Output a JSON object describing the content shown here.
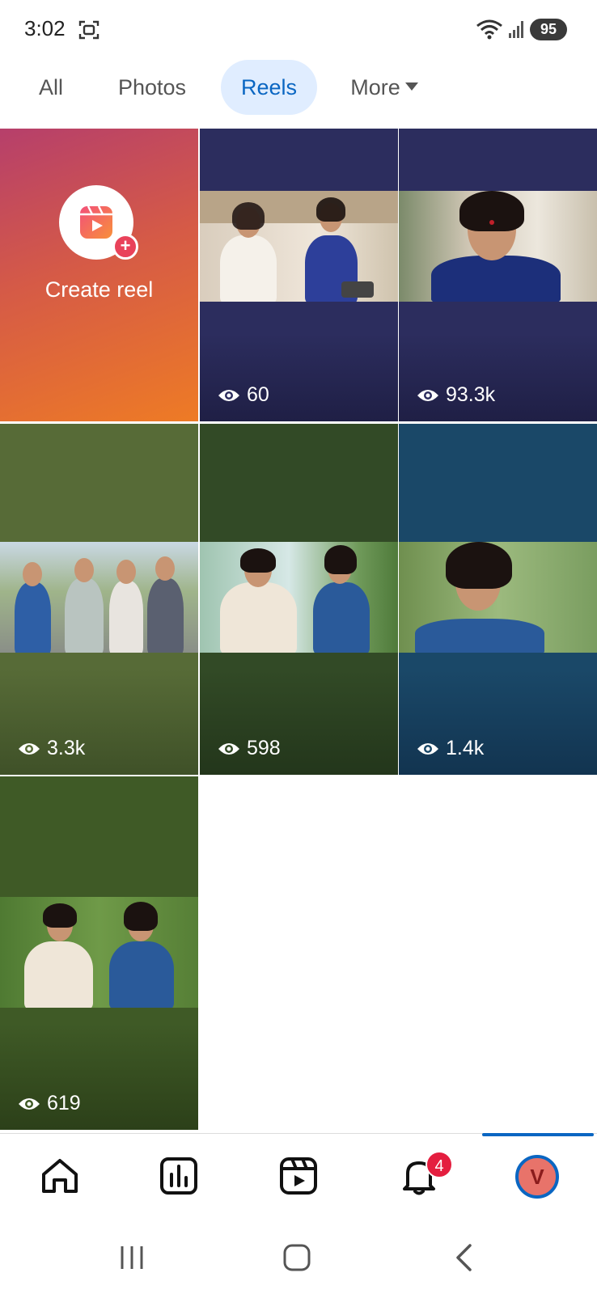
{
  "status_bar": {
    "time": "3:02",
    "battery": "95",
    "icons": [
      "screenshot-icon",
      "wifi-icon",
      "signal-icon",
      "battery-icon"
    ]
  },
  "tabs": [
    {
      "label": "All",
      "selected": false
    },
    {
      "label": "Photos",
      "selected": false
    },
    {
      "label": "Reels",
      "selected": true
    },
    {
      "label": "More",
      "selected": false
    }
  ],
  "create_reel": {
    "label": "Create reel",
    "icon": "reels-icon"
  },
  "reels": [
    {
      "views": "60",
      "bg": "#2c2d5e"
    },
    {
      "views": "93.3k",
      "bg": "#2c2d5e"
    },
    {
      "views": "3.3k",
      "bg": "#576b37"
    },
    {
      "views": "598",
      "bg": "#324a26"
    },
    {
      "views": "1.4k",
      "bg": "#1a4868"
    },
    {
      "views": "619",
      "bg": "#3f5a26"
    }
  ],
  "bottom_nav": {
    "items": [
      "home-icon",
      "insights-icon",
      "reels-icon",
      "bell-icon",
      "profile-avatar"
    ],
    "notification_count": "4",
    "profile_initial": "V"
  },
  "colors": {
    "accent": "#0a66c2",
    "tab_selected_bg": "#e0edff",
    "badge": "#e41e3f"
  }
}
